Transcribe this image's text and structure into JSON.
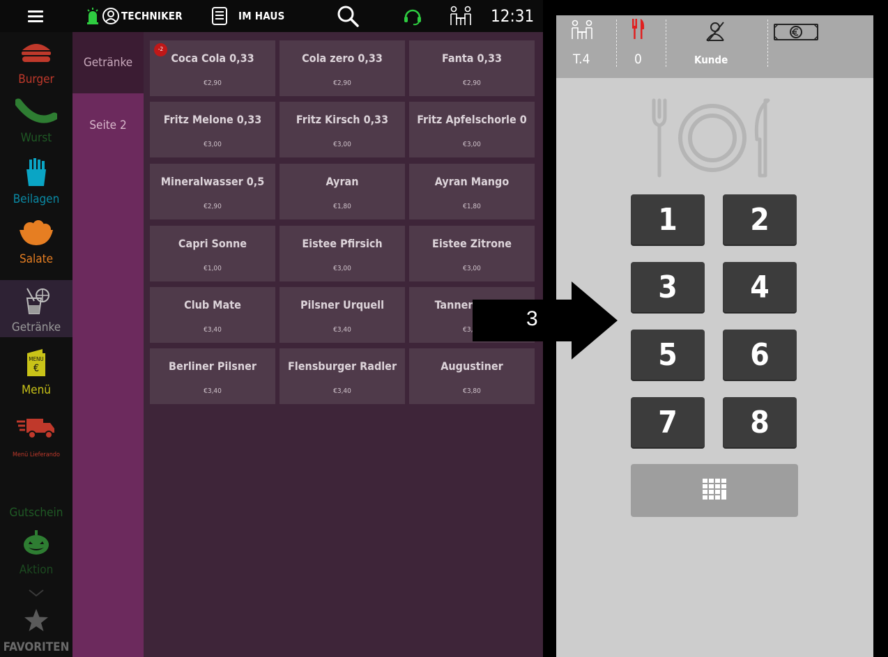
{
  "topbar": {
    "user": "TECHNIKER",
    "mode": "IM HAUS",
    "time": "12:31"
  },
  "categories": [
    {
      "label": "Burger",
      "color": "#c0392b",
      "icon": "burger-icon"
    },
    {
      "label": "Wurst",
      "color": "#2e7d32",
      "icon": "sausage-icon"
    },
    {
      "label": "Beilagen",
      "color": "#0aa5c5",
      "icon": "fries-icon"
    },
    {
      "label": "Salate",
      "color": "#e67e22",
      "icon": "salad-icon"
    },
    {
      "label": "Getränke",
      "color": "#a0a0a0",
      "icon": "drink-icon"
    },
    {
      "label": "Menü",
      "color": "#c9c318",
      "icon": "menu-card-icon"
    },
    {
      "label": "Menü Lieferando",
      "color": "#c0392b",
      "icon": "delivery-truck-icon"
    },
    {
      "label": "Gutschein",
      "color": "#2e7d32",
      "icon": ""
    },
    {
      "label": "Aktion",
      "color": "#2e7d32",
      "icon": "pumpkin-icon"
    },
    {
      "label": "FAVORITEN",
      "color": "#5a5a5a",
      "icon": "star-icon"
    }
  ],
  "menu_badge_text": "MENU",
  "menu_badge_symbol": "€",
  "subcategories": [
    {
      "label": "Getränke"
    },
    {
      "label": "Seite 2"
    }
  ],
  "products": [
    {
      "name": "Coca Cola 0,33",
      "price": "€2,90",
      "badge": "-2"
    },
    {
      "name": "Cola zero 0,33",
      "price": "€2,90"
    },
    {
      "name": "Fanta 0,33",
      "price": "€2,90"
    },
    {
      "name": "Fritz Melone 0,33",
      "price": "€3,00"
    },
    {
      "name": "Fritz Kirsch 0,33",
      "price": "€3,00"
    },
    {
      "name": "Fritz Apfelschorle 0",
      "price": "€3,00"
    },
    {
      "name": "Mineralwasser 0,5",
      "price": "€2,90"
    },
    {
      "name": "Ayran",
      "price": "€1,80"
    },
    {
      "name": "Ayran Mango",
      "price": "€1,80"
    },
    {
      "name": "Capri Sonne",
      "price": "€1,00"
    },
    {
      "name": "Eistee Pfirsich",
      "price": "€3,00"
    },
    {
      "name": "Eistee Zitrone",
      "price": "€3,00"
    },
    {
      "name": "Club Mate",
      "price": "€3,40"
    },
    {
      "name": "Pilsner Urquell",
      "price": "€3,40"
    },
    {
      "name": "Tannenzäpfle",
      "price": "€3,40"
    },
    {
      "name": "Berliner Pilsner",
      "price": "€3,40"
    },
    {
      "name": "Flensburger Radler",
      "price": "€3,40"
    },
    {
      "name": "Augustiner",
      "price": "€3,80"
    }
  ],
  "table_panel": {
    "table": "T.4",
    "guests": "0",
    "customer": "Kunde"
  },
  "keypad": [
    "1",
    "2",
    "3",
    "4",
    "5",
    "6",
    "7",
    "8"
  ],
  "annotation": {
    "label": "3"
  },
  "colors": {
    "accent_green": "#2ecc40",
    "fork_red": "#e02020",
    "subcategory_bg": "#6c2a5d"
  }
}
